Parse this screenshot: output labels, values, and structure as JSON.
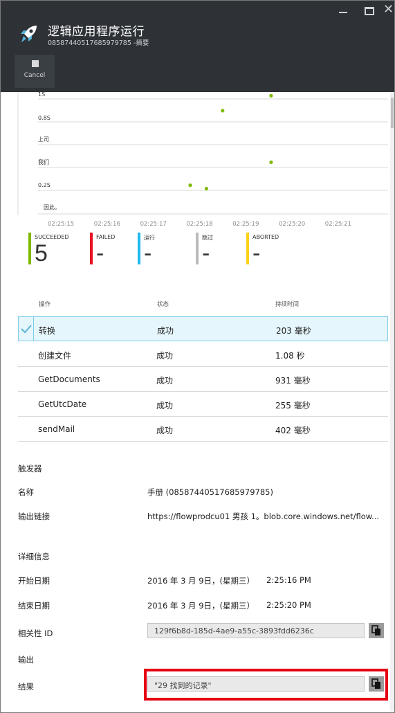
{
  "window": {
    "title": "逻辑应用程序运行",
    "subtitle": "08587440517685979785 -摘要",
    "cancel_label": "Cancel"
  },
  "chart_data": {
    "type": "scatter",
    "y_tick_labels": [
      "1S",
      "0.8S",
      "上司",
      "我们",
      "0.2S",
      "因此。"
    ],
    "x_tick_labels": [
      "02:25:15",
      "02:25:16",
      "02:25:17",
      "02:25:18",
      "02:25:19",
      "02:25:20",
      "02:25:21"
    ],
    "points": [
      {
        "x": "02:25:17.8",
        "y": 0.25
      },
      {
        "x": "02:25:18.15",
        "y": 0.22
      },
      {
        "x": "02:25:18.5",
        "y": 0.9
      },
      {
        "x": "02:25:19.55",
        "y": 0.45
      },
      {
        "x": "02:25:19.55",
        "y": 1.03
      }
    ],
    "ylim": [
      0,
      1.05
    ],
    "grid": true,
    "point_color": "#7fba00"
  },
  "status": [
    {
      "label": "SUCCEEDED",
      "value": "5",
      "color": "#7fba00"
    },
    {
      "label": "FAILED",
      "value": "-",
      "color": "#e81123"
    },
    {
      "label": "运行",
      "value": "-",
      "color": "#1ebbee"
    },
    {
      "label": "跳过",
      "value": "-",
      "color": "#bbbbbb"
    },
    {
      "label": "ABORTED",
      "value": "-",
      "color": "#fcd116"
    }
  ],
  "table": {
    "headers": [
      "操作",
      "状态",
      "持续时间"
    ],
    "rows": [
      {
        "action": "转换",
        "status": "成功",
        "duration": "203 毫秒",
        "selected": true
      },
      {
        "action": "创建文件",
        "status": "成功",
        "duration": "1.08 秒"
      },
      {
        "action": "GetDocuments",
        "status": "成功",
        "duration": "931 毫秒"
      },
      {
        "action": "GetUtcDate",
        "status": "成功",
        "duration": "255 毫秒"
      },
      {
        "action": "sendMail",
        "status": "成功",
        "duration": "402 毫秒"
      }
    ]
  },
  "trigger": {
    "section": "触发器",
    "name_label": "名称",
    "name_value": "手册 (08587440517685979785)",
    "output_link_label": "输出链接",
    "output_link_value": "https://flowprodcu01 男孩 1。blob.core.windows.net/flow..."
  },
  "details": {
    "section": "详细信息",
    "start_label": "开始日期",
    "start_date": "2016 年 3 月 9日，(星期三）",
    "start_time": "2:25:16 PM",
    "end_label": "结束日期",
    "end_date": "2016 年 3 月 9日，(星期三）",
    "end_time": "2:25:20 PM",
    "correlation_label": "相关性 ID",
    "correlation_value": "129f6b8d-185d-4ae9-a55c-3893fdd6236c"
  },
  "outputs": {
    "section": "输出",
    "result_label": "结果",
    "result_value": "\"29 找到的记录\""
  },
  "colors": {
    "header_bg": "#2e3236",
    "selection_bg": "#e5f6fc",
    "selection_border": "#7ccbe8",
    "highlight_border": "#e60012"
  }
}
